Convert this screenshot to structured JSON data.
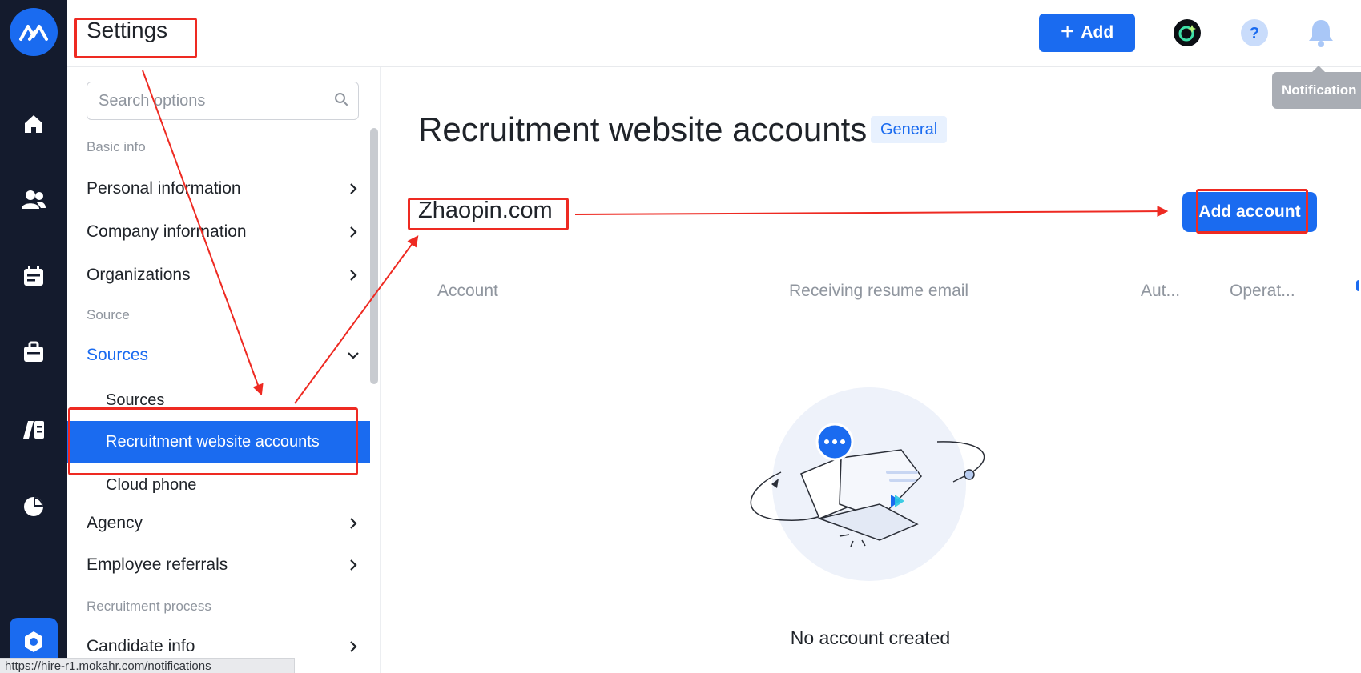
{
  "header": {
    "title": "Settings",
    "add_label": "Add",
    "tooltip": "Notification"
  },
  "sidebar": {
    "search_placeholder": "Search options",
    "sections": {
      "basic": "Basic info",
      "source": "Source",
      "recruitment": "Recruitment process"
    },
    "items": {
      "personal": "Personal information",
      "company": "Company information",
      "organizations": "Organizations",
      "sources": "Sources",
      "sources_sub": "Sources",
      "recruitment_accounts": "Recruitment website accounts",
      "cloud_phone": "Cloud phone",
      "agency": "Agency",
      "employee_referrals": "Employee referrals",
      "candidate_info": "Candidate info"
    }
  },
  "main": {
    "title": "Recruitment website accounts",
    "tag": "General",
    "section_title": "Zhaopin.com",
    "add_account": "Add account",
    "columns": [
      "Account",
      "Receiving resume email",
      "Aut...",
      "Operat..."
    ],
    "empty_text": "No account created"
  },
  "status_url": "https://hire-r1.mokahr.com/notifications",
  "colors": {
    "accent": "#1a6bf0",
    "rail": "#141b2d",
    "annotation": "#ee2a22"
  }
}
